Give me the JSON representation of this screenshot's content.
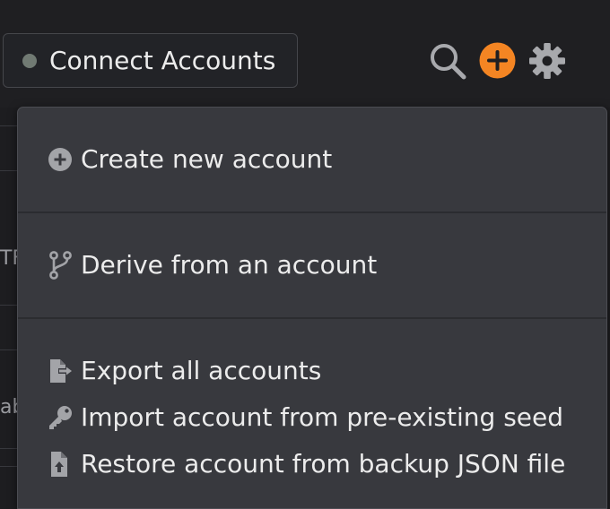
{
  "header": {
    "connect_label": "Connect Accounts",
    "status_color": "#717a73",
    "icons": [
      "search-icon",
      "add-icon",
      "gear-icon"
    ],
    "accent_color": "#f48523"
  },
  "background": {
    "fragment_1": "TF",
    "fragment_2": "ab"
  },
  "menu": {
    "create": "Create new account",
    "derive": "Derive from an account",
    "export": "Export all accounts",
    "import": "Import account from pre-existing seed",
    "restore": "Restore account from backup JSON file"
  }
}
